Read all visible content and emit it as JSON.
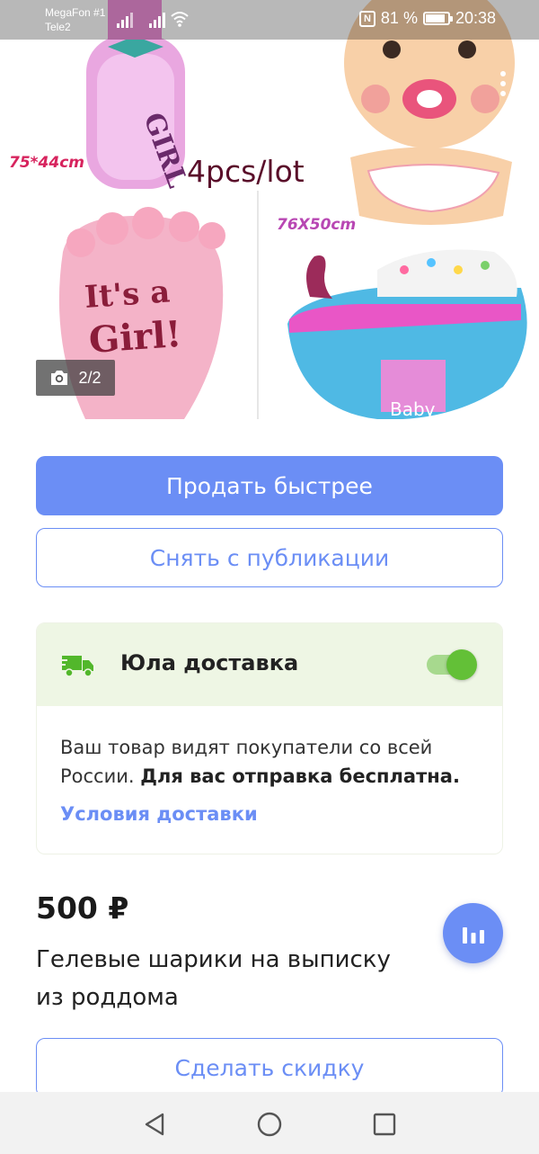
{
  "status_bar": {
    "carrier_1": "MegaFon #1",
    "carrier_2": "Tele2",
    "battery": "81 %",
    "time": "20:38"
  },
  "hero": {
    "photo_counter": "2/2",
    "image_text": {
      "size_1": "75*44cm",
      "lot": "4pcs/lot",
      "size_2": "76X50cm",
      "girl": "GIRL",
      "its_a": "It's a",
      "girl_excl": "Girl!",
      "baby": "Baby"
    }
  },
  "actions": {
    "sell_faster": "Продать быстрее",
    "unpublish": "Снять с публикации",
    "discount": "Сделать скидку"
  },
  "delivery": {
    "title": "Юла доставка",
    "enabled": true,
    "text_plain": "Ваш товар видят покупатели со всей России. ",
    "text_bold": "Для вас отправка бесплатна.",
    "link": "Условия доставки"
  },
  "product": {
    "price": "500 ₽",
    "title": "Гелевые шарики на выписку из роддома"
  },
  "colors": {
    "accent": "#6b8ef5",
    "delivery_bg": "#eef6e4",
    "toggle_on": "#63c037",
    "truck": "#52b72b"
  }
}
